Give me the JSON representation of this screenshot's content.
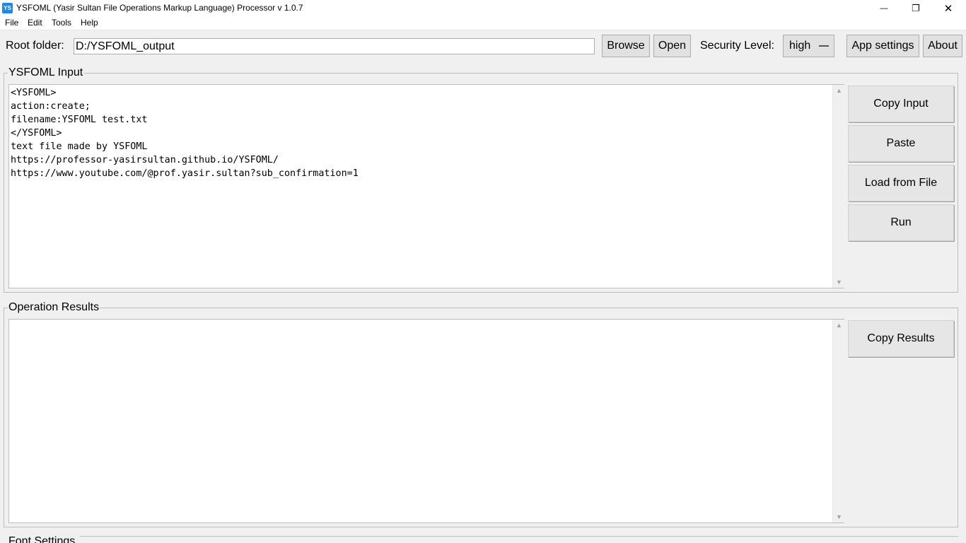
{
  "window": {
    "title": "YSFOML (Yasir Sultan File Operations Markup Language) Processor v 1.0.7",
    "icon_text": "YS",
    "controls": {
      "minimize": "—",
      "maximize": "❐",
      "close": "✕"
    }
  },
  "menu": [
    "File",
    "Edit",
    "Tools",
    "Help"
  ],
  "toolbar": {
    "root_label": "Root folder:",
    "root_value": "D:/YSFOML_output",
    "browse": "Browse",
    "open": "Open",
    "security_label": "Security Level:",
    "security_value": "high",
    "app_settings": "App settings",
    "about": "About"
  },
  "input_group": {
    "title": "YSFOML Input",
    "lines": [
      "<YSFOML>",
      "action:create;",
      "filename:YSFOML test.txt",
      "</YSFOML>",
      "text file made by YSFOML",
      "https://professor-yasirsultan.github.io/YSFOML/",
      "https://www.youtube.com/@prof.yasir.sultan?sub_confirmation=1"
    ],
    "buttons": {
      "copy": "Copy Input",
      "paste": "Paste",
      "load": "Load from File",
      "run": "Run"
    }
  },
  "results_group": {
    "title": "Operation Results",
    "content": "",
    "buttons": {
      "copy": "Copy Results"
    }
  },
  "font_settings_group": {
    "title": "Font Settings"
  },
  "colors": {
    "window_bg": "#f0f0f0",
    "button_bg": "#e1e1e1",
    "icon_blue": "#1e88e5"
  }
}
